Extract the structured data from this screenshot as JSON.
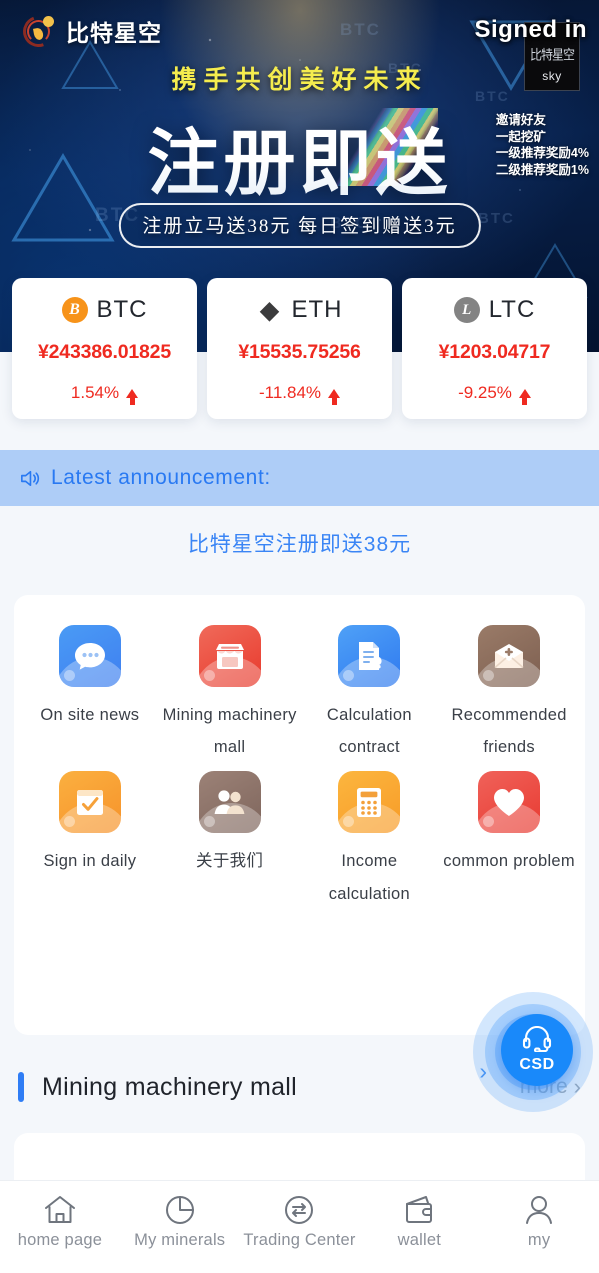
{
  "banner": {
    "brand_name": "比特星空",
    "signed_in": "Signed in",
    "logo_box_cn": "比特星空",
    "logo_box_en": "sky",
    "subtitle": "携手共创美好未来",
    "main_title": "注册即送",
    "pill": "注册立马送38元  每日签到赠送3元",
    "invite_lines": [
      "邀请好友",
      "一起挖矿",
      "一级推荐奖励4%",
      "二级推荐奖励1%"
    ]
  },
  "prices": [
    {
      "symbol": "BTC",
      "icon": "bitcoin-icon",
      "glyph": "B",
      "price": "¥243386.01825",
      "change": "1.54%",
      "direction": "up"
    },
    {
      "symbol": "ETH",
      "icon": "ethereum-icon",
      "glyph": "◆",
      "price": "¥15535.75256",
      "change": "-11.84%",
      "direction": "up"
    },
    {
      "symbol": "LTC",
      "icon": "litecoin-icon",
      "glyph": "L",
      "price": "¥1203.04717",
      "change": "-9.25%",
      "direction": "up"
    }
  ],
  "announcement": {
    "label": "Latest announcement:",
    "content": "比特星空注册即送38元"
  },
  "menu": [
    {
      "label": "On site news",
      "icon": "chat-bubble-icon",
      "theme": "ic-blue"
    },
    {
      "label": "Mining machinery mall",
      "icon": "store-icon",
      "theme": "ic-red"
    },
    {
      "label": "Calculation contract",
      "icon": "contract-icon",
      "theme": "ic-blue2"
    },
    {
      "label": "Recommended friends",
      "icon": "invite-mail-icon",
      "theme": "ic-brown"
    },
    {
      "label": "Sign in daily",
      "icon": "calendar-check-icon",
      "theme": "ic-orange"
    },
    {
      "label": "关于我们",
      "icon": "users-icon",
      "theme": "ic-brown2"
    },
    {
      "label": "Income calculation",
      "icon": "calculator-icon",
      "theme": "ic-orange2"
    },
    {
      "label": "common problem",
      "icon": "heart-icon",
      "theme": "ic-red2"
    }
  ],
  "section": {
    "title": "Mining machinery mall",
    "more": "more",
    "more_chevron": "›",
    "top_chevron": "›"
  },
  "csd": {
    "label": "CSD",
    "icon": "headset-icon"
  },
  "tabbar": [
    {
      "label": "home page",
      "icon": "home-icon",
      "active": true
    },
    {
      "label": "My minerals",
      "icon": "pie-chart-icon",
      "active": false
    },
    {
      "label": "Trading Center",
      "icon": "exchange-icon",
      "active": false
    },
    {
      "label": "wallet",
      "icon": "wallet-icon",
      "active": false
    },
    {
      "label": "my",
      "icon": "user-icon",
      "active": false
    }
  ],
  "colors": {
    "accent_blue": "#2f7df5",
    "price_red": "#ef2a20",
    "announce_bg": "#aecdf7",
    "page_bg": "#f4f7fb"
  }
}
